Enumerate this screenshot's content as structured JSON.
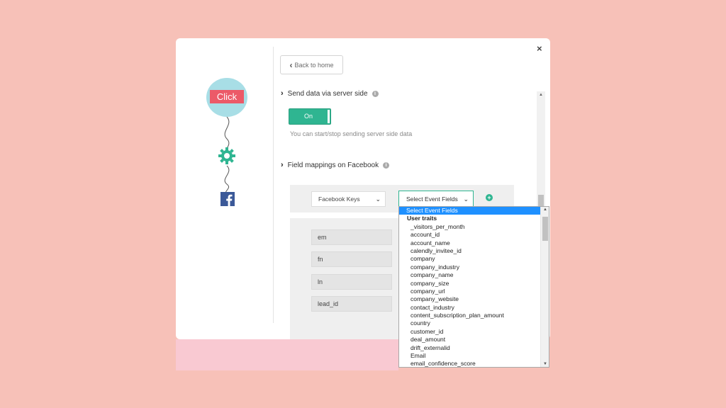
{
  "modal": {
    "close_label": "×"
  },
  "flow": {
    "click_label": "Click",
    "nodes": [
      "click-node",
      "webhook-icon",
      "facebook-icon"
    ]
  },
  "content": {
    "back_button": "Back to home",
    "server_side_title": "Send data via server side",
    "toggle_label": "On",
    "toggle_help": "You can start/stop sending server side data",
    "field_mappings_title": "Field mappings on Facebook"
  },
  "mapping": {
    "keys_select": "Facebook Keys",
    "fields_select": "Select Event Fields",
    "add_label": "+"
  },
  "fields": [
    "em",
    "fn",
    "ln",
    "lead_id"
  ],
  "dropdown": {
    "selected": "Select Event Fields",
    "group": "User traits",
    "options": [
      "_visitors_per_month",
      "account_id",
      "account_name",
      "calendly_invitee_id",
      "company",
      "company_industry",
      "company_name",
      "company_size",
      "company_url",
      "company_website",
      "contact_industry",
      "content_subscription_plan_amount",
      "country",
      "customer_id",
      "deal_amount",
      "drift_externalid",
      "Email",
      "email_confidence_score"
    ]
  },
  "colors": {
    "background": "#f7c1b8",
    "accent": "#2fb591",
    "click_red": "#ec5a68",
    "selected_blue": "#1e90ff"
  }
}
